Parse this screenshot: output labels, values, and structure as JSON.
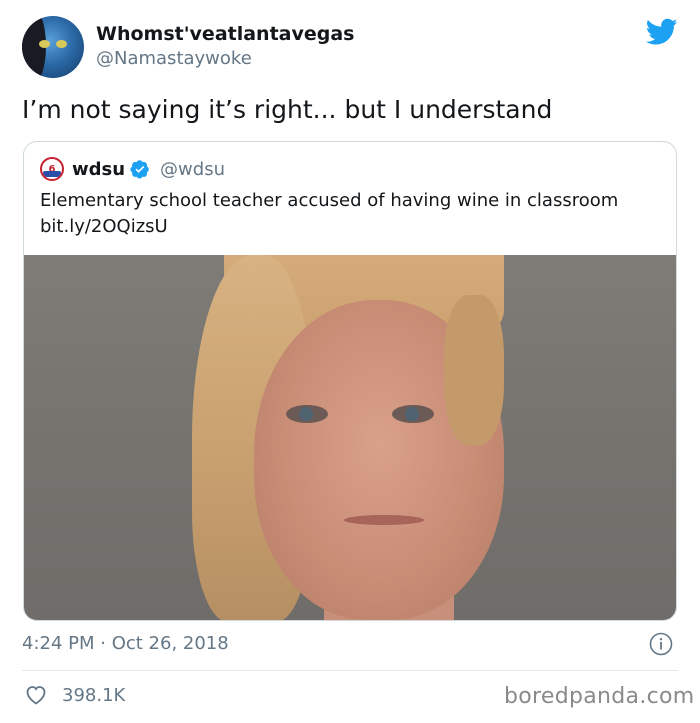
{
  "author": {
    "name": "Whomst'veatlantavegas",
    "handle": "@Namastaywoke"
  },
  "tweet": {
    "text": "I’m not saying it’s right... but I understand",
    "time": "4:24 PM · Oct 26, 2018",
    "like_count": "398.1K"
  },
  "quoted_tweet": {
    "name": "wdsu",
    "handle": "@wdsu",
    "logo_text": "6",
    "text": "Elementary school teacher accused of having wine in classroom",
    "link": "bit.ly/2OQizsU"
  },
  "watermark": "boredpanda.com",
  "icons": {
    "platform": "twitter-bird-icon",
    "verified": "verified-badge-icon",
    "info": "info-icon",
    "like": "heart-icon"
  },
  "colors": {
    "twitter_blue": "#1da1f2",
    "secondary_text": "#657786",
    "primary_text": "#14171a",
    "border": "#cfd9de"
  }
}
